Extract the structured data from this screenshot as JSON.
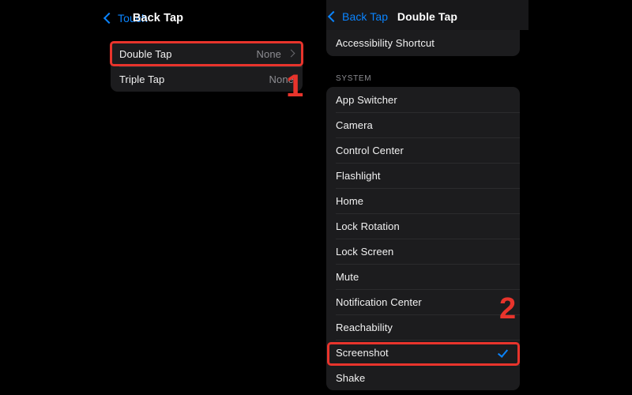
{
  "left_panel": {
    "navbar": {
      "back_label": "Touch",
      "back_icon": "chevron-left-icon",
      "title": "Back Tap"
    },
    "rows": [
      {
        "label": "Double Tap",
        "value": "None",
        "has_chevron": true
      },
      {
        "label": "Triple Tap",
        "value": "None",
        "has_chevron": false
      }
    ]
  },
  "right_panel": {
    "navbar": {
      "back_label": "Back Tap",
      "back_icon": "chevron-left-icon",
      "title": "Double Tap"
    },
    "shortcut_row": {
      "label": "Accessibility Shortcut"
    },
    "section_header": "SYSTEM",
    "rows": [
      {
        "label": "App Switcher",
        "selected": false
      },
      {
        "label": "Camera",
        "selected": false
      },
      {
        "label": "Control Center",
        "selected": false
      },
      {
        "label": "Flashlight",
        "selected": false
      },
      {
        "label": "Home",
        "selected": false
      },
      {
        "label": "Lock Rotation",
        "selected": false
      },
      {
        "label": "Lock Screen",
        "selected": false
      },
      {
        "label": "Mute",
        "selected": false
      },
      {
        "label": "Notification Center",
        "selected": false
      },
      {
        "label": "Reachability",
        "selected": false
      },
      {
        "label": "Screenshot",
        "selected": true
      },
      {
        "label": "Shake",
        "selected": false
      }
    ]
  },
  "annotations": {
    "marker_1": "1",
    "marker_2": "2",
    "highlight_color": "#e8342c",
    "accent_color": "#0a84ff"
  }
}
